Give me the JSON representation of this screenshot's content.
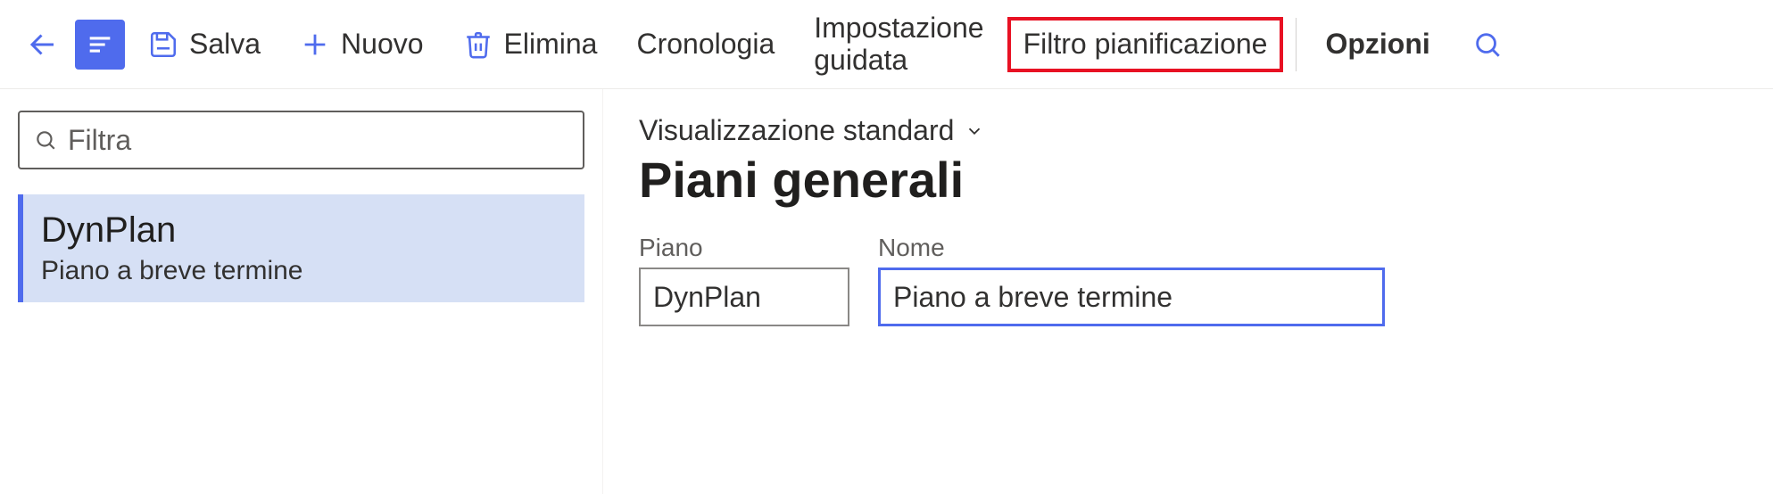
{
  "toolbar": {
    "save_label": "Salva",
    "new_label": "Nuovo",
    "delete_label": "Elimina",
    "history_label": "Cronologia",
    "guided_setup_line1": "Impostazione",
    "guided_setup_line2": "guidata",
    "planning_filter_label": "Filtro pianificazione",
    "options_label": "Opzioni"
  },
  "filter": {
    "placeholder": "Filtra"
  },
  "list": {
    "item_title": "DynPlan",
    "item_subtitle": "Piano a breve termine"
  },
  "view": {
    "selector_label": "Visualizzazione standard",
    "page_title": "Piani generali"
  },
  "form": {
    "piano_label": "Piano",
    "piano_value": "DynPlan",
    "nome_label": "Nome",
    "nome_value": "Piano a breve termine"
  },
  "colors": {
    "accent": "#4f6bed",
    "highlight": "#e81123"
  }
}
